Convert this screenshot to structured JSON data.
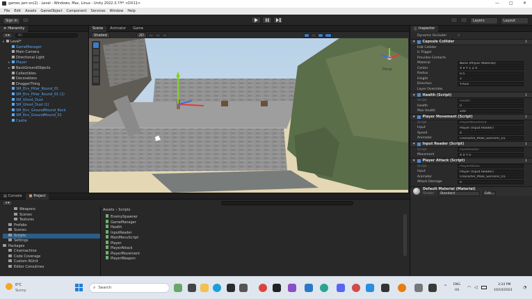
{
  "window": {
    "title": "games jam on(2) - Level - Windows, Mac, Linux - Unity 2022.3.??f* <DX11>",
    "controls": [
      "—",
      "□",
      "✕"
    ]
  },
  "menu": [
    "File",
    "Edit",
    "Assets",
    "GameObject",
    "Component",
    "Services",
    "Window",
    "Help"
  ],
  "toolbar": {
    "account": "Sign in",
    "layers": "Layers",
    "layout": "Layout"
  },
  "hierarchy": {
    "tab": "Hierarchy",
    "search_placeholder": "All",
    "items": [
      {
        "label": "Level*",
        "indent": 0,
        "blue": false
      },
      {
        "label": "GameManager",
        "indent": 1,
        "blue": true
      },
      {
        "label": "Main Camera",
        "indent": 1,
        "blue": false
      },
      {
        "label": "Directional Light",
        "indent": 1,
        "blue": false
      },
      {
        "label": "Player",
        "indent": 1,
        "blue": true
      },
      {
        "label": "BackGroundObjects",
        "indent": 1,
        "blue": false
      },
      {
        "label": "Collectibles",
        "indent": 1,
        "blue": false
      },
      {
        "label": "Decorations",
        "indent": 1,
        "blue": false
      },
      {
        "label": "DraggerThing",
        "indent": 1,
        "blue": false
      },
      {
        "label": "SM_Env_Pillar_Round_01",
        "indent": 1,
        "blue": true
      },
      {
        "label": "SM_Env_Pillar_Round_01 (1)",
        "indent": 1,
        "blue": true
      },
      {
        "label": "SM_Ghost_Dust",
        "indent": 1,
        "blue": true
      },
      {
        "label": "SM_Ghost_Dust (1)",
        "indent": 1,
        "blue": true
      },
      {
        "label": "SM_Env_GroundMound_Rock",
        "indent": 1,
        "blue": true
      },
      {
        "label": "SM_Env_GroundMound_01",
        "indent": 1,
        "blue": true
      },
      {
        "label": "Castle",
        "indent": 1,
        "blue": true
      }
    ]
  },
  "scene": {
    "tabs": [
      "Scene",
      "Animator",
      "Game"
    ],
    "shading": "Shaded",
    "mode": "2D",
    "gizmo_label": "Persp"
  },
  "inspector": {
    "tab": "Inspector",
    "top_rows": [
      {
        "label": "Dynamic Occluder",
        "value": "✓"
      }
    ],
    "components": [
      {
        "title": "Capsule Collider",
        "props": [
          {
            "label": "Edit Collider",
            "value": ""
          },
          {
            "label": "Is Trigger",
            "value": ""
          },
          {
            "label": "Provides Contacts",
            "value": ""
          },
          {
            "label": "Material",
            "value": "None (Physic Material)"
          },
          {
            "label": "Center",
            "value": "X 0    Y 1    Z 0"
          },
          {
            "label": "Radius",
            "value": "0.5"
          },
          {
            "label": "Height",
            "value": "2"
          },
          {
            "label": "Direction",
            "value": "Y-Axis"
          },
          {
            "label": "Layer Overrides",
            "value": ""
          }
        ]
      },
      {
        "title": "Health (Script)",
        "props": [
          {
            "label": "Script",
            "value": "Health"
          },
          {
            "label": "Health",
            "value": "0"
          },
          {
            "label": "Max Health",
            "value": "100"
          }
        ]
      },
      {
        "title": "Player Movement (Script)",
        "props": [
          {
            "label": "Script",
            "value": "PlayerMovement"
          },
          {
            "label": "Input",
            "value": "Player (Input Reader)"
          },
          {
            "label": "Speed",
            "value": "4"
          },
          {
            "label": "Animator",
            "value": "Character_Male_Sorcerer_01"
          }
        ]
      },
      {
        "title": "Input Reader (Script)",
        "props": [
          {
            "label": "Script",
            "value": "InputReader"
          },
          {
            "label": "Movement",
            "value": "X 0    Y 0"
          }
        ]
      },
      {
        "title": "Player Attack (Script)",
        "props": [
          {
            "label": "Script",
            "value": "PlayerAttack"
          },
          {
            "label": "Input",
            "value": "Player (Input Reader)"
          },
          {
            "label": "Animator",
            "value": "Character_Male_Sorcerer_01"
          },
          {
            "label": "Attack Damage",
            "value": "0"
          }
        ]
      }
    ],
    "material": {
      "title": "Default Material (Material)",
      "shader_label": "Shader",
      "shader": "Standard",
      "edit": "Edit..."
    }
  },
  "project": {
    "tabs": [
      "Console",
      "Project"
    ],
    "breadcrumb": [
      "Assets",
      "Scripts"
    ],
    "tree": [
      {
        "label": "Weapons",
        "indent": 2
      },
      {
        "label": "Scenes",
        "indent": 2
      },
      {
        "label": "Textures",
        "indent": 2
      },
      {
        "label": "Prefabs",
        "indent": 1
      },
      {
        "label": "Scenes",
        "indent": 1
      },
      {
        "label": "Scripts",
        "indent": 1
      },
      {
        "label": "Settings",
        "indent": 1
      },
      {
        "label": "Packages",
        "indent": 0
      },
      {
        "label": "Cinemachine",
        "indent": 1
      },
      {
        "label": "Code Coverage",
        "indent": 1
      },
      {
        "label": "Custom NUnit",
        "indent": 1
      },
      {
        "label": "Editor Coroutines",
        "indent": 1
      }
    ],
    "files": [
      "EnemySpawner",
      "GameManager",
      "Health",
      "InputReader",
      "MainMenuScript",
      "Player",
      "PlayerAttack",
      "PlayerMovement",
      "PlayerWeapon"
    ]
  },
  "taskbar": {
    "weather_temp": "0°C",
    "weather_desc": "Sunny",
    "search": "Search",
    "lang": "ENG",
    "region": "US",
    "time": "3:24 PM",
    "date": "10/10/2023"
  },
  "colors": {
    "accent_blue": "#5aa9f7",
    "editor_bg": "#282828",
    "taskbar_bg": "#dfe6ee"
  }
}
